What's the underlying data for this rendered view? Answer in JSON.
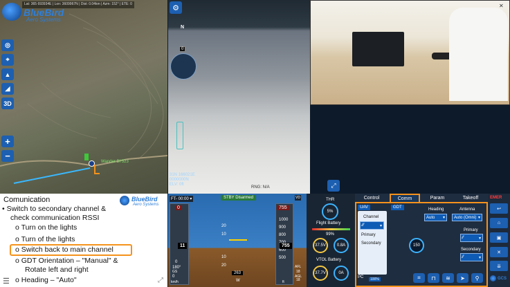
{
  "map": {
    "stats": {
      "lat": "Lat: 365 693934E",
      "lon": "Lon: 3609967N",
      "dist": "Dist: 0.04km",
      "azm": "Azm: 152°",
      "ete": "ETE: 0"
    },
    "brand": {
      "name": "BlueBird",
      "sub": "Aero Systems"
    },
    "buttons": {
      "b3d": "3D",
      "plus": "+",
      "minus": "−"
    },
    "waypoint_label": "Wander BI 523"
  },
  "camera": {
    "compass_n": "N",
    "heading_readout": "0",
    "coords": {
      "line1": "31N 166021E",
      "line2": "0000000N",
      "elv": "ELV: 0ft"
    },
    "rng": "RNG: N/A"
  },
  "slide": {
    "title": "Comunication",
    "brand": {
      "name": "BlueBird",
      "sub": "Aero Systems"
    },
    "bullets": [
      "• Switch to secondary channel &",
      "   check communication RSSI",
      "o Turn on the lights",
      "o Turn of the lights",
      "o Switch back to main channel",
      "o GDT Orientation – \"Manual\" &",
      "   Rotate left and right",
      "o Heading – \"Auto\""
    ]
  },
  "pfd": {
    "ft_label": "FT- 00:00 ▾",
    "status": "STBY Disarmed",
    "vd": "VD",
    "left_tape": {
      "top": "0",
      "current": "11",
      "bottom": "0",
      "b2": "180°"
    },
    "right_tape": {
      "top": "755",
      "ticks": [
        "1000",
        "900",
        "800",
        "700",
        "600",
        "500"
      ],
      "current": "755"
    },
    "pitch": [
      "20",
      "10",
      "10",
      "20"
    ],
    "heading": "263",
    "heading_w": "W",
    "gs_label": "GS",
    "gs_val": "0",
    "gs_unit": "km/h",
    "afl": "AFL",
    "afl_val": "18",
    "agl": "AGL",
    "agl_val": "18",
    "ft": "ft"
  },
  "gauges": {
    "thr": "THR",
    "thr_val": "5%",
    "flight_battery": "Flight Battery",
    "fb_pct": "99%",
    "fb_v": "37.5V",
    "fb_a": "0.8A",
    "vtol_battery": "VTOL Battery",
    "vb_v": "37.7V",
    "vb_a": "0A"
  },
  "panel": {
    "tabs": [
      "Control",
      "Comm",
      "Param",
      "Takeoff"
    ],
    "uav": "UAV",
    "gdt": "GDT",
    "channel": "Channel",
    "primary": "Primary",
    "secondary": "Secondary",
    "heading": "Heading",
    "heading_val": "Auto",
    "antenna": "Antenna",
    "antenna_val": "Auto (Omni)",
    "primary2": "Primary",
    "secondary2": "Secondary",
    "rssi_val": "150",
    "pc": "PC",
    "pc_val": "100%"
  },
  "rightbar": {
    "emer": "EMER",
    "gcs": "GCS"
  },
  "colors": {
    "accent": "#f5921b",
    "brand": "#2f7fd8",
    "button": "#1d5fb0"
  }
}
